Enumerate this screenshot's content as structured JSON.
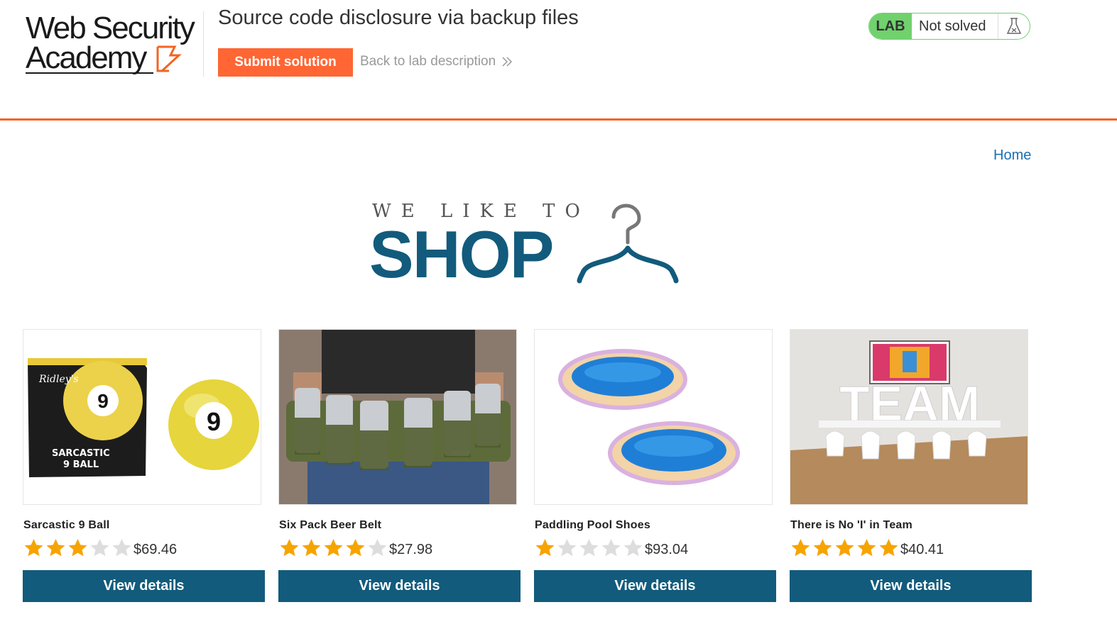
{
  "header": {
    "logo_line1": "Web Security",
    "logo_line2": "Academy",
    "lab_title": "Source code disclosure via backup files",
    "submit_label": "Submit solution",
    "back_label": "Back to lab description",
    "status_tag": "LAB",
    "status_text": "Not solved"
  },
  "nav": {
    "home_label": "Home"
  },
  "hero": {
    "subtitle": "WE LIKE TO",
    "title": "SHOP"
  },
  "colors": {
    "accent": "#ff6633",
    "brand_blue": "#125b7c",
    "status_green": "#70d16d",
    "star_gold": "#f6a400",
    "star_empty": "#dddddd"
  },
  "products": [
    {
      "name": "Sarcastic 9 Ball",
      "rating": 3,
      "price": "$69.46",
      "button": "View details",
      "image": "sarcastic-9-ball-image"
    },
    {
      "name": "Six Pack Beer Belt",
      "rating": 4,
      "price": "$27.98",
      "button": "View details",
      "image": "beer-belt-image"
    },
    {
      "name": "Paddling Pool Shoes",
      "rating": 1,
      "price": "$93.04",
      "button": "View details",
      "image": "pool-shoes-image"
    },
    {
      "name": "There is No 'I' in Team",
      "rating": 5,
      "price": "$40.41",
      "button": "View details",
      "image": "team-image"
    }
  ]
}
